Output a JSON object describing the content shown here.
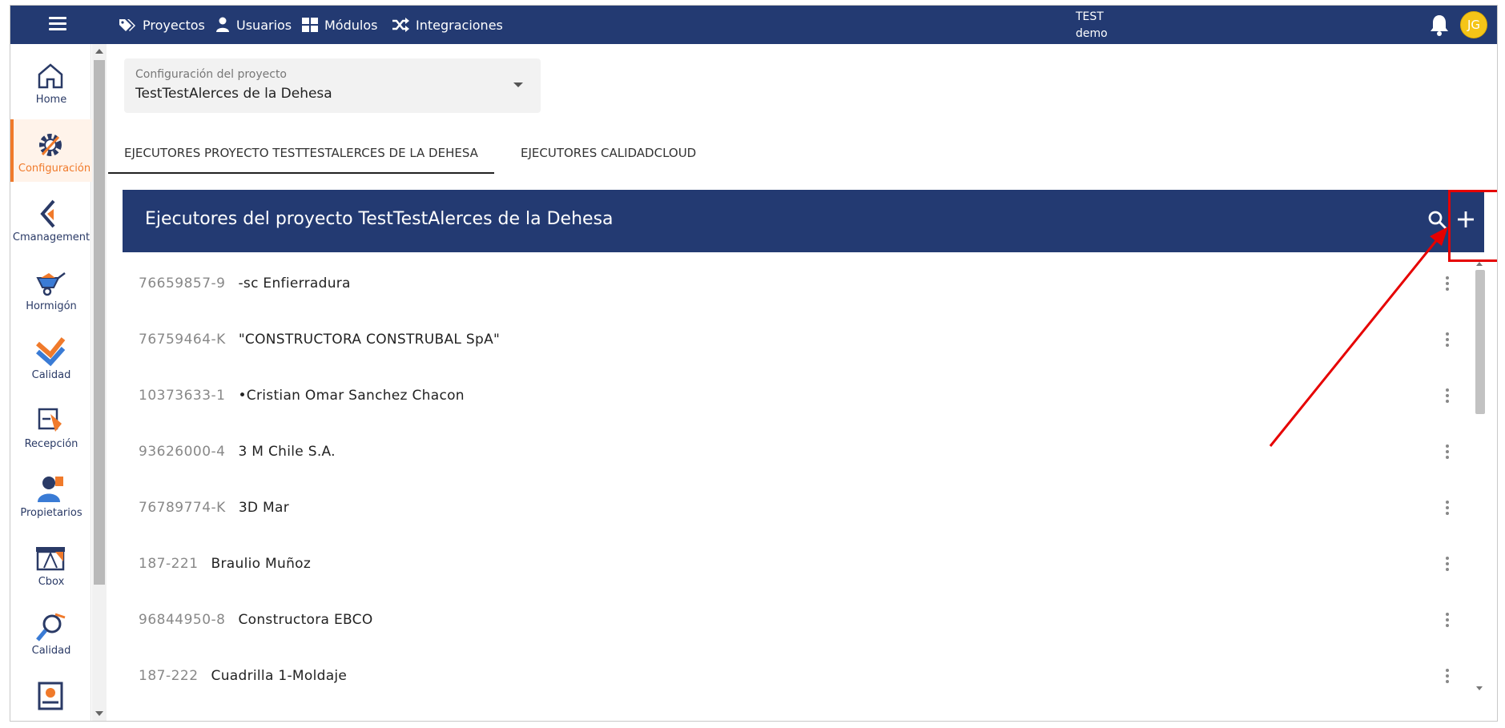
{
  "topbar": {
    "nav": [
      {
        "label": "Proyectos",
        "icon": "tags-icon"
      },
      {
        "label": "Usuarios",
        "icon": "user-icon"
      },
      {
        "label": "Módulos",
        "icon": "grid-icon"
      },
      {
        "label": "Integraciones",
        "icon": "shuffle-icon"
      }
    ],
    "env_line1": "TEST",
    "env_line2": "demo",
    "avatar_initials": "JG"
  },
  "sidebar": {
    "items": [
      {
        "label": "Home",
        "icon": "home-icon"
      },
      {
        "label": "Configuración",
        "icon": "gear-icon",
        "active": true
      },
      {
        "label": "Cmanagement",
        "icon": "cmanagement-icon"
      },
      {
        "label": "Hormigón",
        "icon": "wheelbarrow-icon"
      },
      {
        "label": "Calidad",
        "icon": "check-layers-icon"
      },
      {
        "label": "Recepción",
        "icon": "reception-icon"
      },
      {
        "label": "Propietarios",
        "icon": "owner-icon"
      },
      {
        "label": "Cbox",
        "icon": "cbox-icon"
      },
      {
        "label": "Calidad",
        "icon": "magnifier-icon"
      },
      {
        "label": "",
        "icon": "budget-icon"
      }
    ]
  },
  "project_select": {
    "caption": "Configuración del proyecto",
    "value": "TestTestAlerces de la Dehesa"
  },
  "tabs": [
    {
      "label": "EJECUTORES PROYECTO TESTTESTALERCES DE LA DEHESA",
      "active": true
    },
    {
      "label": "EJECUTORES CALIDADCLOUD",
      "active": false
    }
  ],
  "panel": {
    "title": "Ejecutores del proyecto TestTestAlerces de la Dehesa"
  },
  "rows": [
    {
      "rut": "76659857-9",
      "name": "-sc Enfierradura"
    },
    {
      "rut": "76759464-K",
      "name": "\"CONSTRUCTORA CONSTRUBAL SpA\""
    },
    {
      "rut": "10373633-1",
      "name": "•Cristian Omar Sanchez Chacon"
    },
    {
      "rut": "93626000-4",
      "name": "3 M Chile S.A."
    },
    {
      "rut": "76789774-K",
      "name": "3D Mar"
    },
    {
      "rut": "187-221",
      "name": "Braulio Muñoz"
    },
    {
      "rut": "96844950-8",
      "name": "Constructora EBCO"
    },
    {
      "rut": "187-222",
      "name": "Cuadrilla 1-Moldaje"
    }
  ],
  "colors": {
    "primary": "#233a72",
    "accent": "#f07a2b",
    "annotation": "#e60000",
    "avatar": "#f5c518"
  }
}
